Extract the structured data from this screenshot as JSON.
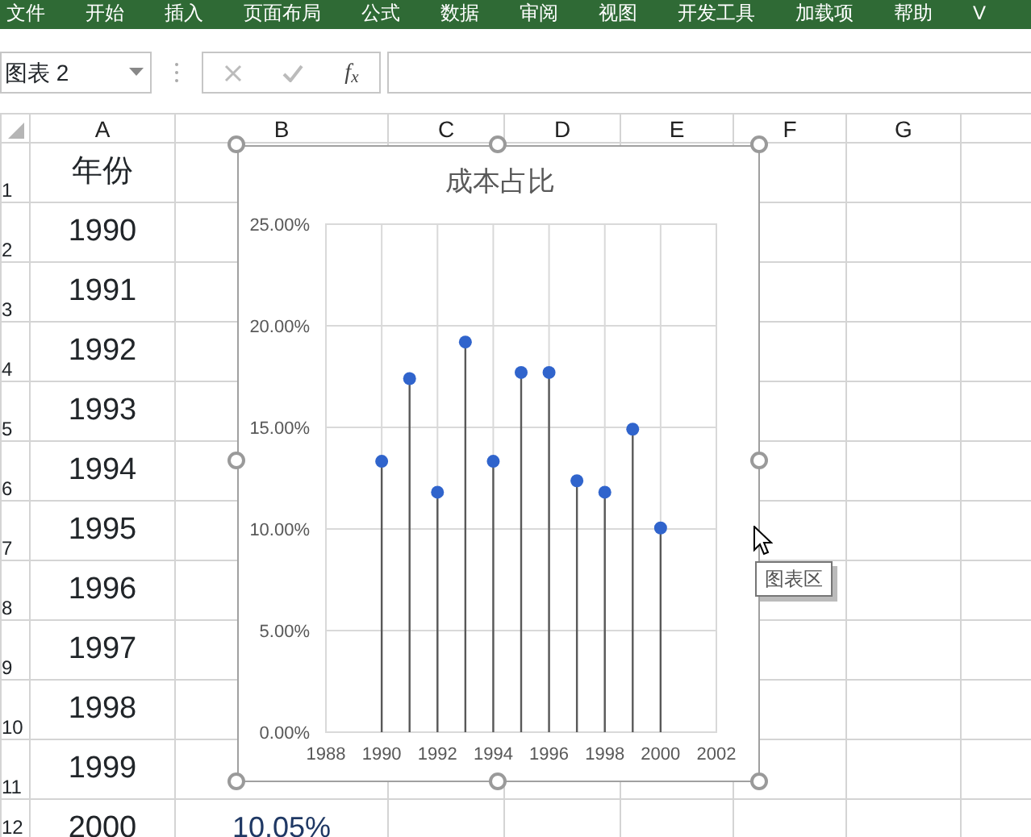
{
  "menu_tabs": [
    "文件",
    "开始",
    "插入",
    "页面布局",
    "公式",
    "数据",
    "审阅",
    "视图",
    "开发工具",
    "加载项",
    "帮助",
    "V"
  ],
  "name_box": {
    "value": "图表 2"
  },
  "formula_bar": {
    "fx_label": "f$_{x}$"
  },
  "columns": [
    "A",
    "B",
    "C",
    "D",
    "E",
    "F",
    "G"
  ],
  "rows": [
    {
      "header": "1",
      "a": "年份"
    },
    {
      "header": "2",
      "a": "1990"
    },
    {
      "header": "3",
      "a": "1991"
    },
    {
      "header": "4",
      "a": "1992"
    },
    {
      "header": "5",
      "a": "1993"
    },
    {
      "header": "6",
      "a": "1994"
    },
    {
      "header": "7",
      "a": "1995"
    },
    {
      "header": "8",
      "a": "1996"
    },
    {
      "header": "9",
      "a": "1997"
    },
    {
      "header": "10",
      "a": "1998"
    },
    {
      "header": "11",
      "a": "1999"
    },
    {
      "header": "12",
      "a": "2000",
      "b": "10.05%"
    }
  ],
  "chart": {
    "chart_data": {
      "type": "scatter",
      "title": "成本占比",
      "x": [
        1990,
        1991,
        1992,
        1993,
        1994,
        1995,
        1996,
        1997,
        1998,
        1999,
        2000
      ],
      "series": [
        {
          "color": "#3064cc",
          "values": [
            0.1333,
            0.174,
            0.1181,
            0.192,
            0.1333,
            0.177,
            0.177,
            0.1237,
            0.1181,
            0.1491,
            0.1005
          ],
          "errors": [
            [
              0.1333,
              0
            ],
            [
              0.174,
              0
            ],
            [
              0.1181,
              0
            ],
            [
              0.192,
              0
            ],
            [
              0.1333,
              0
            ],
            [
              0.177,
              0
            ],
            [
              0.177,
              0
            ],
            [
              0.1237,
              0
            ],
            [
              0.1181,
              0
            ],
            [
              0.1491,
              0
            ],
            [
              0.1005,
              0
            ]
          ]
        }
      ],
      "xlim": [
        1988,
        2002
      ],
      "ylim": [
        0,
        0.25
      ],
      "grid": true,
      "xticks": [
        1988,
        1990,
        1992,
        1994,
        1996,
        1998,
        2000,
        2002
      ],
      "yticks": [
        {
          "value": 0,
          "label": "0.00%"
        },
        {
          "value": 0.05,
          "label": "5.00%"
        },
        {
          "value": 0.1,
          "label": "10.00%"
        },
        {
          "value": 0.15,
          "label": "15.00%"
        },
        {
          "value": 0.2,
          "label": "20.00%"
        },
        {
          "value": 0.25,
          "label": "25.00%"
        }
      ]
    }
  },
  "tooltip": "图表区"
}
